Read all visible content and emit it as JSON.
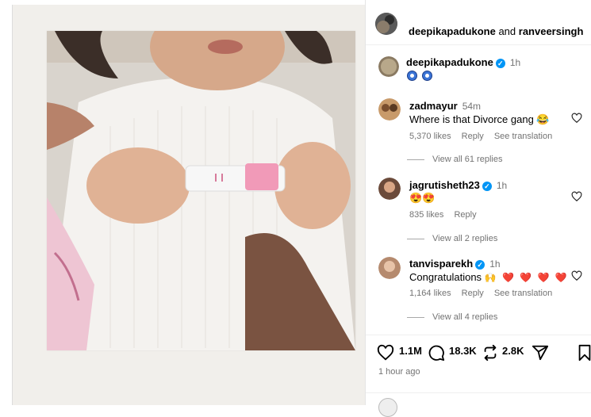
{
  "header": {
    "user1": "deepikapadukone",
    "joiner": "and",
    "user2": "ranveersingh"
  },
  "caption": {
    "username": "deepikapadukone",
    "time": "1h",
    "emojis": "🧿🧿"
  },
  "comments": [
    {
      "username": "zadmayur",
      "time": "54m",
      "text": "Where is that Divorce gang",
      "emoji": "😂",
      "likes": "5,370 likes",
      "reply": "Reply",
      "translate": "See translation",
      "replies": "View all 61 replies"
    },
    {
      "username": "jagrutisheth23",
      "time": "1h",
      "text": "",
      "emoji": "😍😍",
      "likes": "835 likes",
      "reply": "Reply",
      "replies": "View all 2 replies"
    },
    {
      "username": "tanvisparekh",
      "time": "1h",
      "text": "Congratulations",
      "emoji": "🙌 ❤️ ❤️ ❤️ ❤️",
      "likes": "1,164 likes",
      "reply": "Reply",
      "translate": "See translation",
      "replies": "View all 4 replies"
    }
  ],
  "actions": {
    "likes": "1.1M",
    "comments": "18.3K",
    "shares": "2.8K"
  },
  "posted": "1 hour ago",
  "colors": {
    "verified": "#0095f6",
    "muted": "#737373"
  }
}
